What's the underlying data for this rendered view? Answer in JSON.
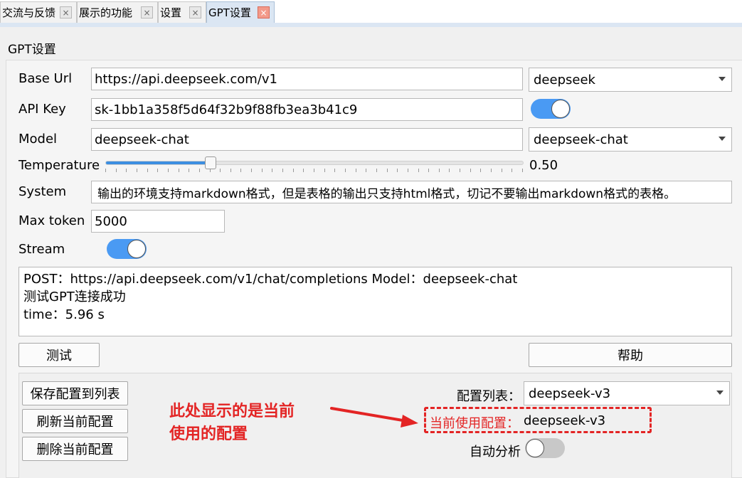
{
  "tabs": [
    {
      "label": "交流与反馈",
      "close": "×",
      "active": false
    },
    {
      "label": "展示的功能",
      "close": "×",
      "active": false
    },
    {
      "label": "设置",
      "close": "×",
      "active": false
    },
    {
      "label": "GPT设置",
      "close": "×",
      "active": true
    }
  ],
  "group_title": "GPT设置",
  "form": {
    "base_url": {
      "label": "Base Url",
      "value": "https://api.deepseek.com/v1",
      "provider": "deepseek"
    },
    "api_key": {
      "label": "API Key",
      "value": "sk-1bb1a358f5d64f32b9f88fb3ea3b41c9",
      "visible_toggle": true
    },
    "model": {
      "label": "Model",
      "value": "deepseek-chat",
      "selected": "deepseek-chat"
    },
    "temperature": {
      "label": "Temperature",
      "value": 0.5,
      "display": "0.50",
      "min": 0,
      "max": 2
    },
    "system": {
      "label": "System",
      "value": "输出的环境支持markdown格式，但是表格的输出只支持html格式，切记不要输出markdown格式的表格。"
    },
    "max_token": {
      "label": "Max token",
      "value": "5000"
    },
    "stream": {
      "label": "Stream",
      "on": true
    }
  },
  "output": {
    "lines": [
      "POST：https://api.deepseek.com/v1/chat/completions  Model：deepseek-chat",
      "测试GPT连接成功",
      "time：5.96 s"
    ]
  },
  "buttons": {
    "test": "测试",
    "help": "帮助"
  },
  "config": {
    "save": "保存配置到列表",
    "refresh": "刷新当前配置",
    "delete": "删除当前配置",
    "list_label": "配置列表：",
    "list_selected": "deepseek-v3",
    "current_label": "当前使用配置：",
    "current_value": "deepseek-v3",
    "auto_analysis_label": "自动分析",
    "auto_analysis_on": false
  },
  "annotation": {
    "line1": "此处显示的是当前",
    "line2": "使用的配置",
    "color": "#e32424"
  },
  "colors": {
    "accent": "#4a9af3",
    "tab_active": "#dbe6f3",
    "close_active": "#f39a8a"
  },
  "icons": [
    "close-icon",
    "chevron-down-icon",
    "arrow-right-icon"
  ]
}
